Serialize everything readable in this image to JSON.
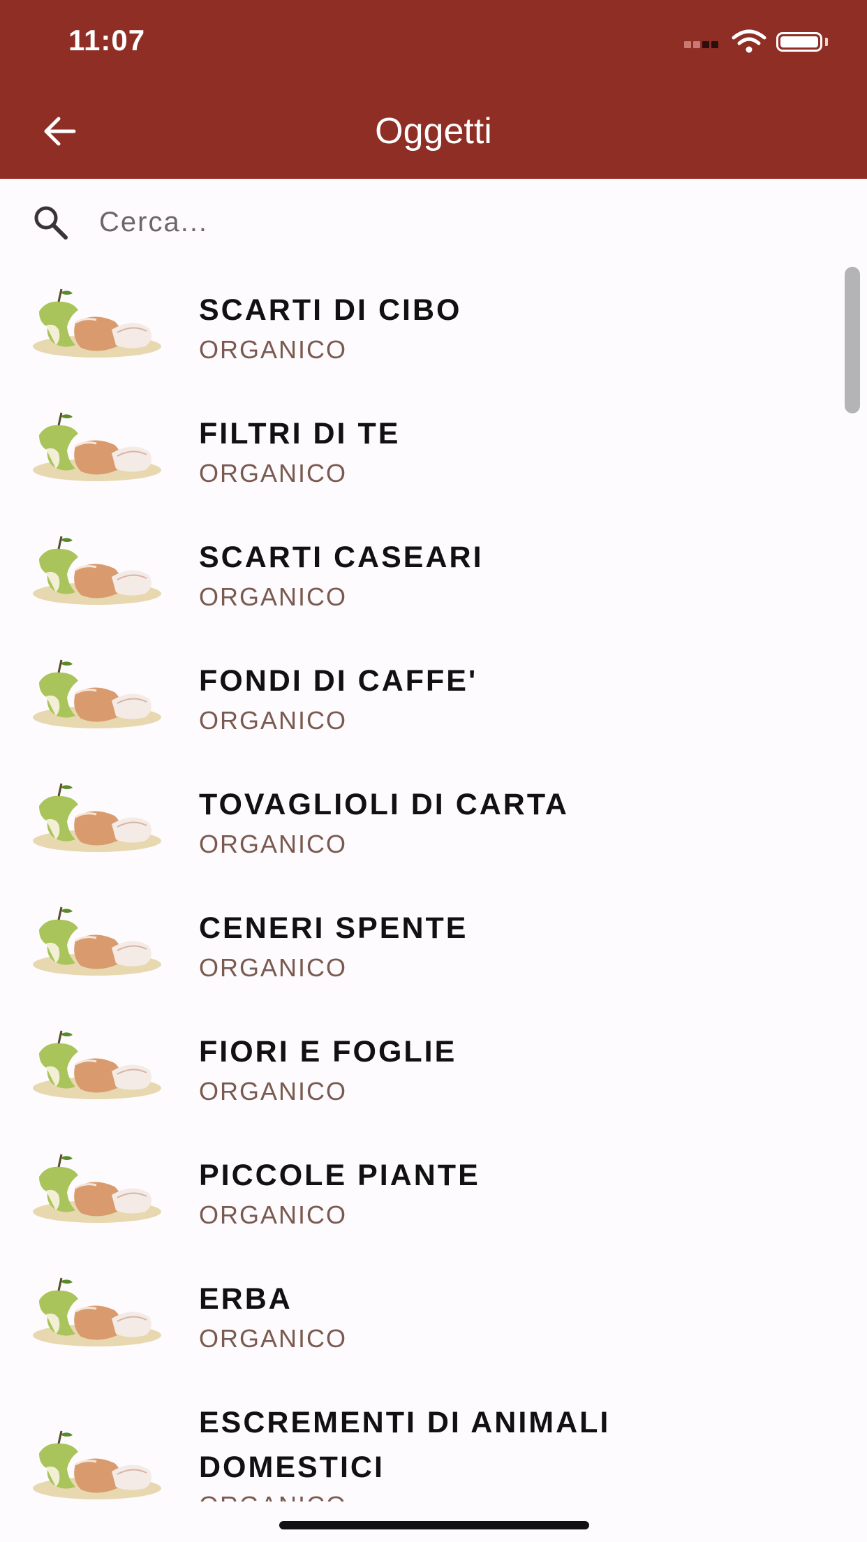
{
  "status_bar": {
    "time": "11:07"
  },
  "header": {
    "title": "Oggetti"
  },
  "search": {
    "placeholder": "Cerca..."
  },
  "items": [
    {
      "title": "SCARTI DI CIBO",
      "category": "ORGANICO"
    },
    {
      "title": "FILTRI DI TE",
      "category": "ORGANICO"
    },
    {
      "title": "SCARTI CASEARI",
      "category": "ORGANICO"
    },
    {
      "title": "FONDI DI CAFFE'",
      "category": "ORGANICO"
    },
    {
      "title": "TOVAGLIOLI DI CARTA",
      "category": "ORGANICO"
    },
    {
      "title": "CENERI SPENTE",
      "category": "ORGANICO"
    },
    {
      "title": "FIORI E FOGLIE",
      "category": "ORGANICO"
    },
    {
      "title": "PICCOLE PIANTE",
      "category": "ORGANICO"
    },
    {
      "title": "ERBA",
      "category": "ORGANICO"
    },
    {
      "title": "ESCREMENTI DI ANIMALI DOMESTICI",
      "category": "ORGANICO"
    }
  ],
  "icons": {
    "back": "arrow-left-icon",
    "search": "search-icon",
    "item_thumbnail": "organic-waste-icon"
  },
  "colors": {
    "app_bar": "#8e2e25",
    "category_text": "#7a5a50"
  }
}
